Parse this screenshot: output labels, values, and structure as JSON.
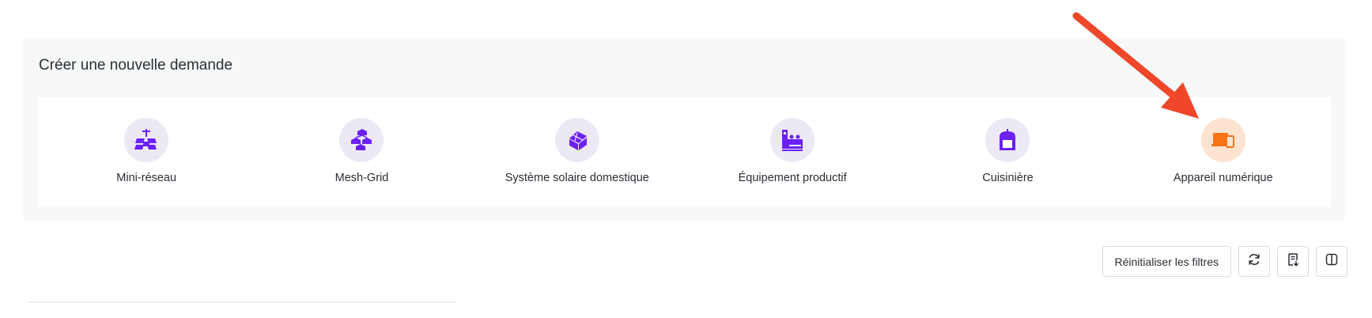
{
  "card": {
    "title": "Créer une nouvelle demande",
    "options": [
      {
        "label": "Mini-réseau",
        "icon": "mini-grid-icon"
      },
      {
        "label": "Mesh-Grid",
        "icon": "mesh-grid-icon"
      },
      {
        "label": "Système solaire domestique",
        "icon": "solar-home-icon"
      },
      {
        "label": "Équipement productif",
        "icon": "productive-equipment-icon"
      },
      {
        "label": "Cuisinière",
        "icon": "cookstove-icon"
      },
      {
        "label": "Appareil numérique",
        "icon": "digital-device-icon",
        "highlighted": true
      }
    ]
  },
  "toolbar": {
    "reset_label": "Réinitialiser les filtres",
    "refresh_icon": "refresh-icon",
    "export_icon": "export-document-icon",
    "columns_icon": "columns-icon"
  },
  "colors": {
    "accent": "#6b21f5",
    "highlight": "#f97316",
    "annotation_arrow": "#f0462a"
  }
}
